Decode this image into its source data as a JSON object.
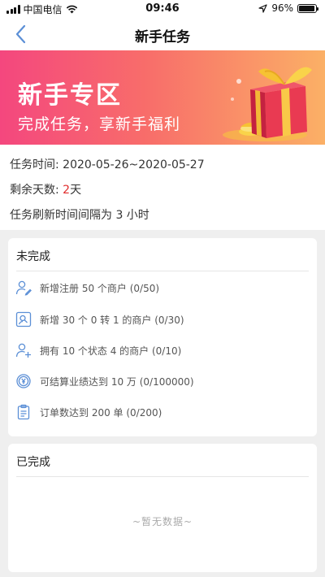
{
  "status_bar": {
    "carrier": "中国电信",
    "time": "09:46",
    "battery": "96%",
    "battery_level": 0.96
  },
  "nav": {
    "title": "新手任务",
    "back_icon": "chevron-left-icon"
  },
  "banner": {
    "title": "新手专区",
    "subtitle": "完成任务，享新手福利"
  },
  "info": {
    "period_label": "任务时间: ",
    "period_value": "2020-05-26~2020-05-27",
    "days_label": "剩余天数: ",
    "days_value": "2",
    "days_unit": "天",
    "refresh_text": "任务刷新时间间隔为 3 小时"
  },
  "incomplete": {
    "title": "未完成",
    "tasks": [
      {
        "label": "新增注册 50 个商户 (0/50)",
        "icon": "user-edit-icon"
      },
      {
        "label": "新增 30 个 0 转 1 的商户 (0/30)",
        "icon": "user-search-icon"
      },
      {
        "label": "拥有 10 个状态 4 的商户 (0/10)",
        "icon": "user-add-icon"
      },
      {
        "label": "可结算业绩达到 10 万 (0/100000)",
        "icon": "coin-yen-icon"
      },
      {
        "label": "订单数达到 200 单 (0/200)",
        "icon": "clipboard-icon"
      }
    ]
  },
  "completed": {
    "title": "已完成",
    "empty_text": "~暂无数据~"
  },
  "colors": {
    "accent": "#5b8fd6",
    "highlight": "#e02c2c",
    "banner_start": "#f4477e",
    "banner_end": "#fbb066"
  }
}
